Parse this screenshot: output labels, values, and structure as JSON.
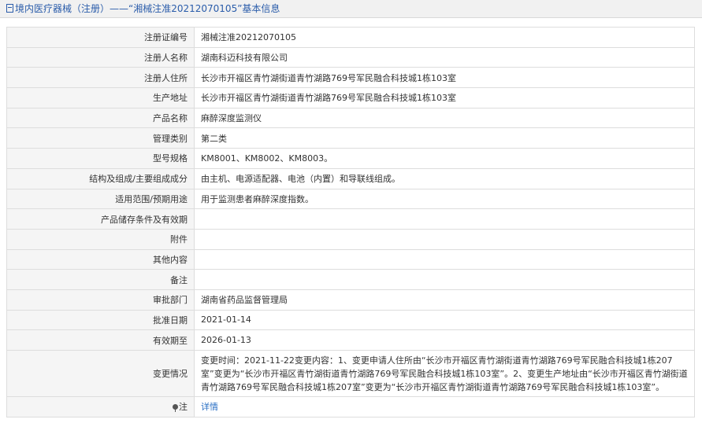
{
  "header": {
    "icon": "document-icon",
    "title": "境内医疗器械（注册）——“湘械注准20212070105”基本信息"
  },
  "fields": [
    {
      "label": "注册证编号",
      "value": "湘械注准20212070105"
    },
    {
      "label": "注册人名称",
      "value": "湖南科迈科技有限公司"
    },
    {
      "label": "注册人住所",
      "value": "长沙市开福区青竹湖街道青竹湖路769号军民融合科技城1栋103室"
    },
    {
      "label": "生产地址",
      "value": "长沙市开福区青竹湖街道青竹湖路769号军民融合科技城1栋103室"
    },
    {
      "label": "产品名称",
      "value": "麻醉深度监测仪"
    },
    {
      "label": "管理类别",
      "value": "第二类"
    },
    {
      "label": "型号规格",
      "value": "KM8001、KM8002、KM8003。"
    },
    {
      "label": "结构及组成/主要组成成分",
      "value": "由主机、电源适配器、电池（内置）和导联线组成。"
    },
    {
      "label": "适用范围/预期用途",
      "value": "用于监测患者麻醉深度指数。"
    },
    {
      "label": "产品储存条件及有效期",
      "value": ""
    },
    {
      "label": "附件",
      "value": ""
    },
    {
      "label": "其他内容",
      "value": ""
    },
    {
      "label": "备注",
      "value": ""
    },
    {
      "label": "审批部门",
      "value": "湖南省药品监督管理局"
    },
    {
      "label": "批准日期",
      "value": "2021-01-14"
    },
    {
      "label": "有效期至",
      "value": "2026-01-13"
    },
    {
      "label": "变更情况",
      "value": "变更时间：2021-11-22变更内容：1、变更申请人住所由“长沙市开福区青竹湖街道青竹湖路769号军民融合科技城1栋207室”变更为“长沙市开福区青竹湖街道青竹湖路769号军民融合科技城1栋103室”。2、变更生产地址由“长沙市开福区青竹湖街道青竹湖路769号军民融合科技城1栋207室”变更为“长沙市开福区青竹湖街道青竹湖路769号军民融合科技城1栋103室”。"
    }
  ],
  "note": {
    "icon": "pin-icon",
    "label": "注",
    "link_text": "详情"
  }
}
